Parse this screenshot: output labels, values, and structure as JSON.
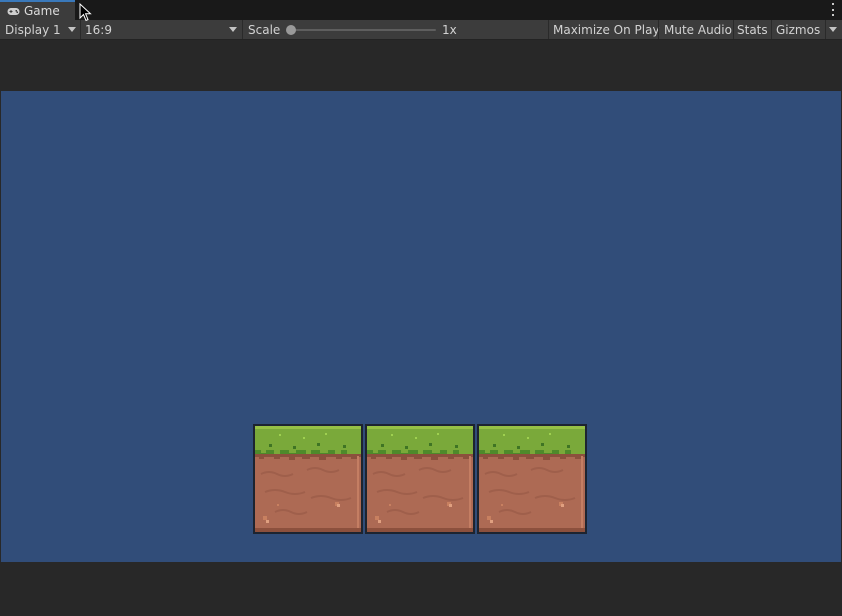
{
  "tab": {
    "label": "Game",
    "icon": "gamepad-icon"
  },
  "toolbar": {
    "display_label": "Display 1",
    "aspect_label": "16:9",
    "scale_label": "Scale",
    "scale_value": "1x",
    "scale_slider_fraction": 0.0,
    "maximize_label": "Maximize On Play",
    "mute_label": "Mute Audio",
    "stats_label": "Stats",
    "gizmos_label": "Gizmos"
  },
  "game": {
    "background_color": "#314d79",
    "tiles": [
      "grass-dirt-tile",
      "grass-dirt-tile",
      "grass-dirt-tile"
    ]
  }
}
